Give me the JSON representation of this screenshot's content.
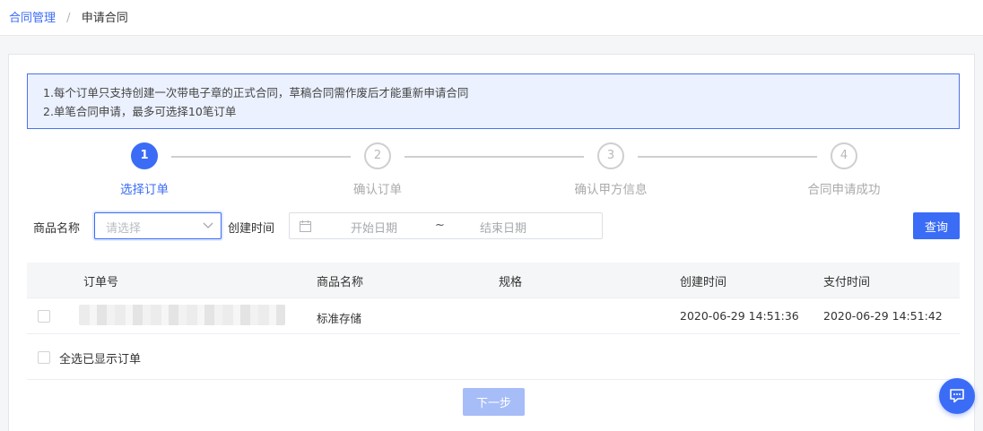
{
  "breadcrumb": {
    "parent": "合同管理",
    "separator": "/",
    "current": "申请合同"
  },
  "notice": {
    "line1": "1.每个订单只支持创建一次带电子章的正式合同，草稿合同需作废后才能重新申请合同",
    "line2": "2.单笔合同申请，最多可选择10笔订单"
  },
  "steps": [
    {
      "number": "1",
      "label": "选择订单",
      "state": "active"
    },
    {
      "number": "2",
      "label": "确认订单",
      "state": "pending"
    },
    {
      "number": "3",
      "label": "确认甲方信息",
      "state": "pending"
    },
    {
      "number": "4",
      "label": "合同申请成功",
      "state": "pending"
    }
  ],
  "filters": {
    "product_label": "商品名称",
    "product_placeholder": "请选择",
    "created_label": "创建时间",
    "start_placeholder": "开始日期",
    "range_separator": "~",
    "end_placeholder": "结束日期",
    "query_button": "查询"
  },
  "table": {
    "headers": {
      "order_no": "订单号",
      "product": "商品名称",
      "spec": "规格",
      "created": "创建时间",
      "paid": "支付时间"
    },
    "rows": [
      {
        "order_no": "",
        "product": "标准存储",
        "spec": "",
        "created": "2020-06-29 14:51:36",
        "paid": "2020-06-29 14:51:42"
      }
    ]
  },
  "select_all_label": "全选已显示订单",
  "next_button": "下一步",
  "colors": {
    "primary": "#3b6cf6",
    "disabled": "#a7bdf8",
    "notice_bg": "#ebf1fe"
  }
}
